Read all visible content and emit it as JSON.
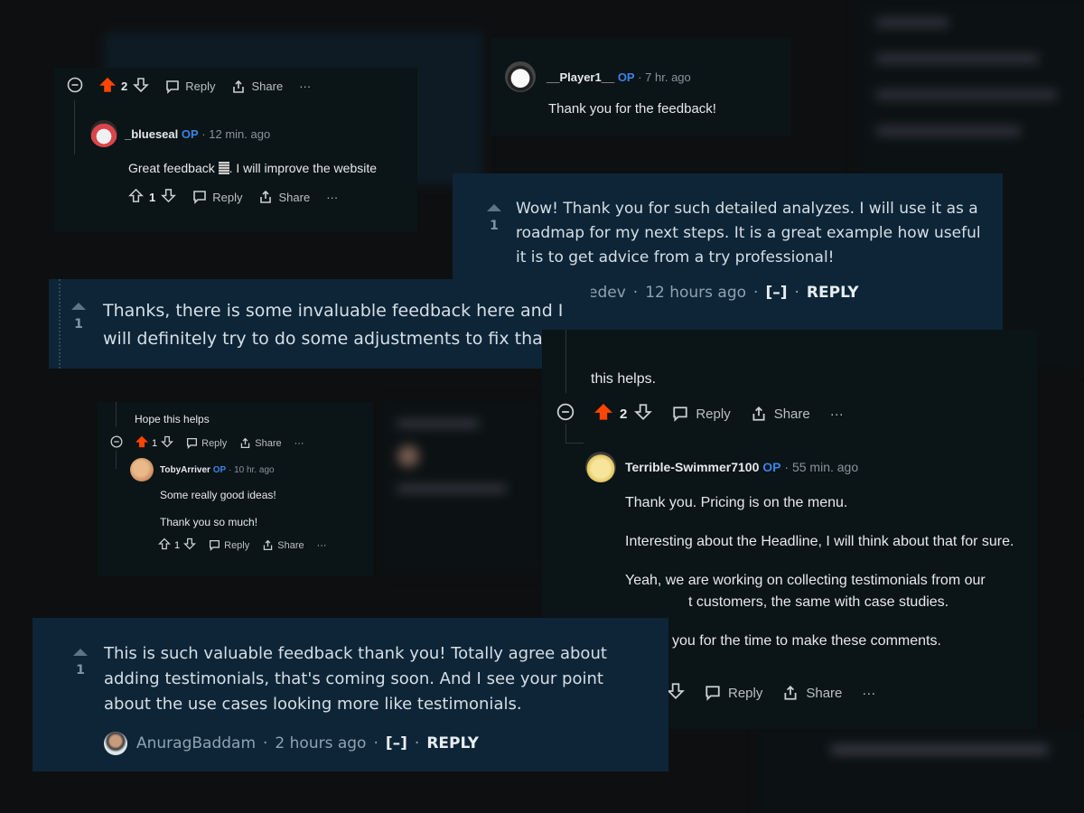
{
  "card_blueseal": {
    "top_votes": "2",
    "reply": "Reply",
    "share": "Share",
    "more": "···",
    "user": "_blueseal",
    "op": "OP",
    "time": "12 min. ago",
    "text": "Great feedback ",
    "text_after": ". I will improve the website",
    "votes": "1"
  },
  "card_player": {
    "user": "__Player1__",
    "op": "OP",
    "time": "7 hr. ago",
    "text": "Thank you for the feedback!"
  },
  "card_wow": {
    "votes": "1",
    "text": "Wow! Thank you for such detailed analyzes. I will use it as a roadmap for my next steps. It is a great example how useful it is to get advice from a try professional!",
    "user_partial": "edev",
    "time": "12 hours ago",
    "collapse": "[–]",
    "reply": "REPLY"
  },
  "card_thanks": {
    "votes": "1",
    "text": "Thanks, there is some invaluable feedback here and I will definitely try to do some adjustments to fix that."
  },
  "card_toby": {
    "parent_text": "Hope this helps",
    "parent_votes": "1",
    "reply": "Reply",
    "share": "Share",
    "more": "···",
    "user": "TobyArriver",
    "op": "OP",
    "time": "10 hr. ago",
    "line1": "Some really good ideas!",
    "line2": "Thank you so much!",
    "votes": "1"
  },
  "card_terrible": {
    "parent_text": "this helps.",
    "parent_votes": "2",
    "reply": "Reply",
    "share": "Share",
    "more": "···",
    "user": "Terrible-Swimmer7100",
    "op": "OP",
    "time": "55 min. ago",
    "p1": "Thank you. Pricing is on the menu.",
    "p2": "Interesting about the Headline, I will think about that for sure.",
    "p3a": "Yeah, we are working on collecting testimonials from our",
    "p3b": "t customers, the same with case studies.",
    "p4": "you for the time to make these comments."
  },
  "card_valuable": {
    "votes": "1",
    "text": "This is such valuable feedback thank you! Totally agree about adding testimonials, that's coming soon. And I see your point about the use cases looking more like testimonials.",
    "user": "AnuragBaddam",
    "time": "2 hours ago",
    "collapse": "[–]",
    "reply": "REPLY"
  },
  "colors": {
    "upvote": "#ff4500",
    "op_blue": "#3a83e8",
    "navy_card": "#0e2537",
    "dark_card": "#0b1416"
  }
}
